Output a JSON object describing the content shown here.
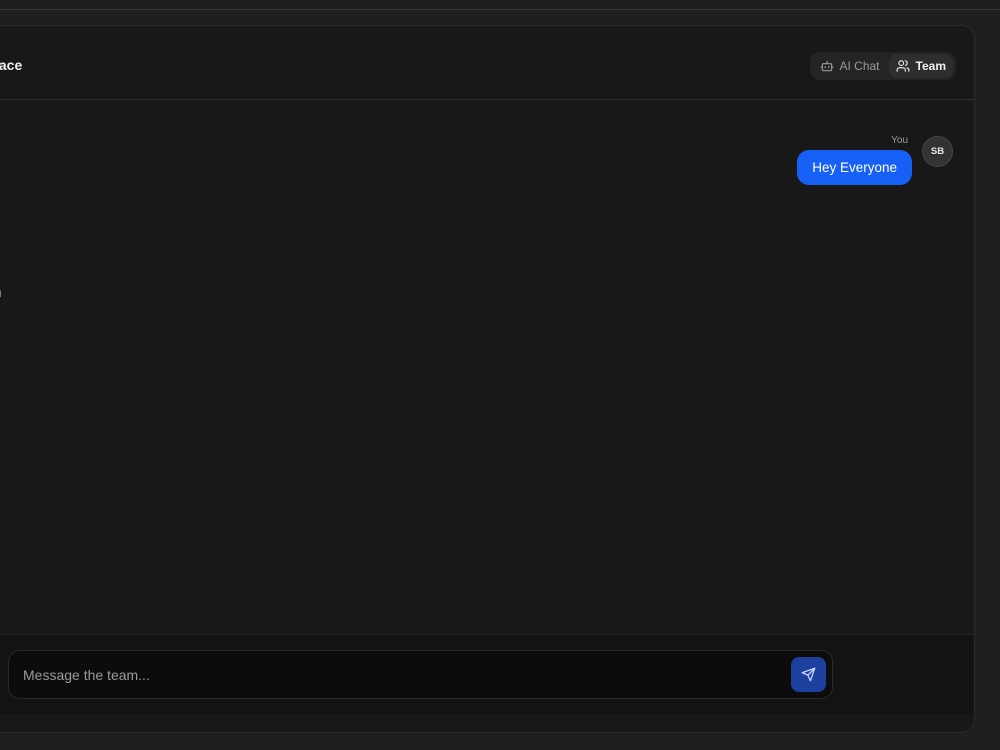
{
  "header": {
    "title": "erface"
  },
  "mode_switch": {
    "ai_chat": {
      "label": "AI Chat",
      "icon": "bot-icon"
    },
    "team": {
      "label": "Team",
      "icon": "users-icon",
      "active": true
    }
  },
  "messages": [
    {
      "sender": "You",
      "text": "Hey Everyone",
      "avatar_initials": "SB"
    }
  ],
  "side_stamp": "AN",
  "composer": {
    "placeholder": "Message the team...",
    "value": "",
    "send_icon": "send-icon"
  },
  "colors": {
    "accent": "#1660f6",
    "send_button": "#1d3f9e",
    "panel": "#181818",
    "background": "#1f1f1f"
  }
}
